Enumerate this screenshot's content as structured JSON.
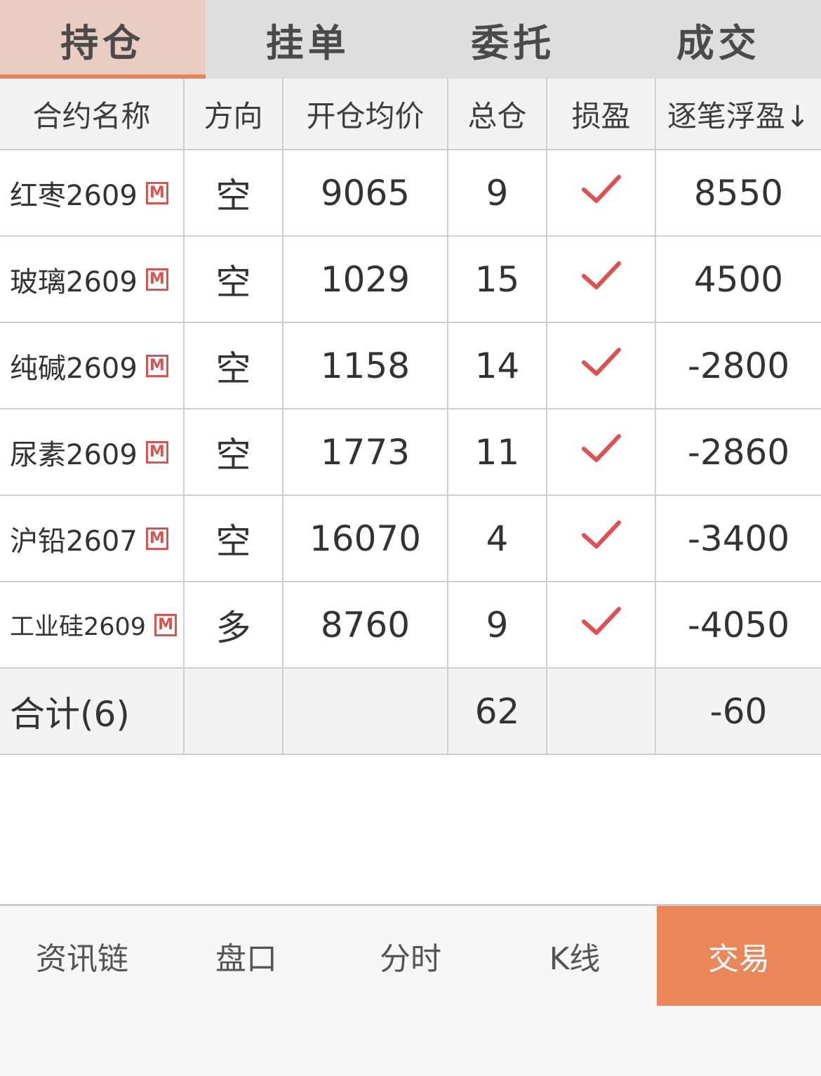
{
  "tabs": [
    {
      "label": "持仓",
      "active": true
    },
    {
      "label": "挂单",
      "active": false
    },
    {
      "label": "委托",
      "active": false
    },
    {
      "label": "成交",
      "active": false
    }
  ],
  "columns": [
    "合约名称",
    "方向",
    "开仓均价",
    "总仓",
    "损盈",
    "逐笔浮盈↓"
  ],
  "rows": [
    {
      "name": "红枣2609",
      "badge": "M",
      "direction": "空",
      "dir_type": "short",
      "avg_price": "9065",
      "total": "9",
      "check_icon": "checkmark-icon",
      "pnl": "8550",
      "pnl_sign": "pos"
    },
    {
      "name": "玻璃2609",
      "badge": "M",
      "direction": "空",
      "dir_type": "short",
      "avg_price": "1029",
      "total": "15",
      "check_icon": "checkmark-icon",
      "pnl": "4500",
      "pnl_sign": "pos"
    },
    {
      "name": "纯碱2609",
      "badge": "M",
      "direction": "空",
      "dir_type": "short",
      "avg_price": "1158",
      "total": "14",
      "check_icon": "checkmark-icon",
      "pnl": "-2800",
      "pnl_sign": "neg"
    },
    {
      "name": "尿素2609",
      "badge": "M",
      "direction": "空",
      "dir_type": "short",
      "avg_price": "1773",
      "total": "11",
      "check_icon": "checkmark-icon",
      "pnl": "-2860",
      "pnl_sign": "neg"
    },
    {
      "name": "沪铅2607",
      "badge": "M",
      "direction": "空",
      "dir_type": "short",
      "avg_price": "16070",
      "total": "4",
      "check_icon": "checkmark-icon",
      "pnl": "-3400",
      "pnl_sign": "neg"
    },
    {
      "name": "工业硅2609",
      "badge": "M",
      "direction": "多",
      "dir_type": "long",
      "avg_price": "8760",
      "total": "9",
      "check_icon": "checkmark-icon",
      "pnl": "-4050",
      "pnl_sign": "neg"
    }
  ],
  "summary": {
    "label": "合计(6)",
    "total": "62",
    "pnl": "-60"
  },
  "bottom_nav": [
    {
      "label": "资讯链",
      "active": false
    },
    {
      "label": "盘口",
      "active": false
    },
    {
      "label": "分时",
      "active": false
    },
    {
      "label": "K线",
      "active": false
    },
    {
      "label": "交易",
      "active": true
    }
  ],
  "colors": {
    "accent": "#ea8657",
    "profit": "#dd5656",
    "loss": "#3a9266",
    "check": "#e05050"
  }
}
